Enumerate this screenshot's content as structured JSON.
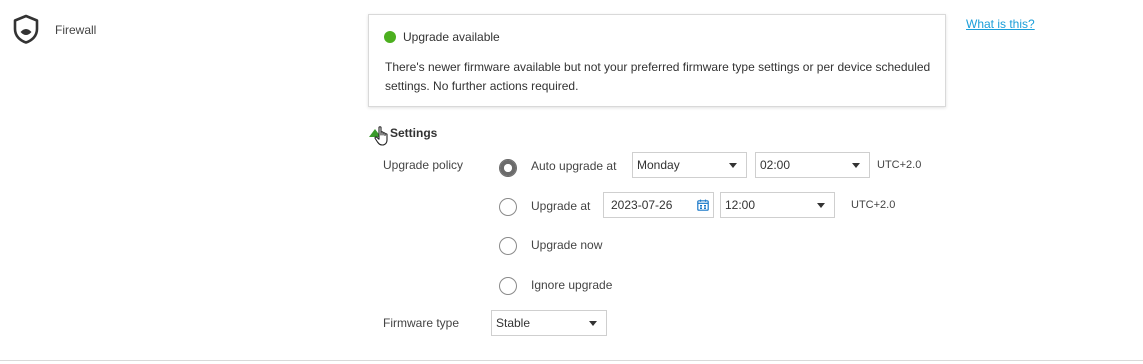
{
  "device": {
    "name": "Firewall",
    "icon": "shield-icon"
  },
  "status": {
    "color": "#4caf1f",
    "title": "Upgrade available",
    "message": "There's newer firmware available but not your preferred firmware type settings or per device scheduled settings. No further actions required."
  },
  "help_link": "What is this?",
  "settings": {
    "title": "Settings",
    "upgrade_policy_label": "Upgrade policy",
    "options": {
      "auto": {
        "label": "Auto upgrade at",
        "selected": true,
        "day": "Monday",
        "time": "02:00",
        "tz": "UTC+2.0"
      },
      "at": {
        "label": "Upgrade at",
        "selected": false,
        "date": "2023-07-26",
        "time": "12:00",
        "tz": "UTC+2.0"
      },
      "now": {
        "label": "Upgrade now",
        "selected": false
      },
      "ignore": {
        "label": "Ignore upgrade",
        "selected": false
      }
    },
    "firmware_type_label": "Firmware type",
    "firmware_type": "Stable"
  },
  "colors": {
    "accent": "#1a9ed9",
    "caret": "#3a9a2a"
  }
}
